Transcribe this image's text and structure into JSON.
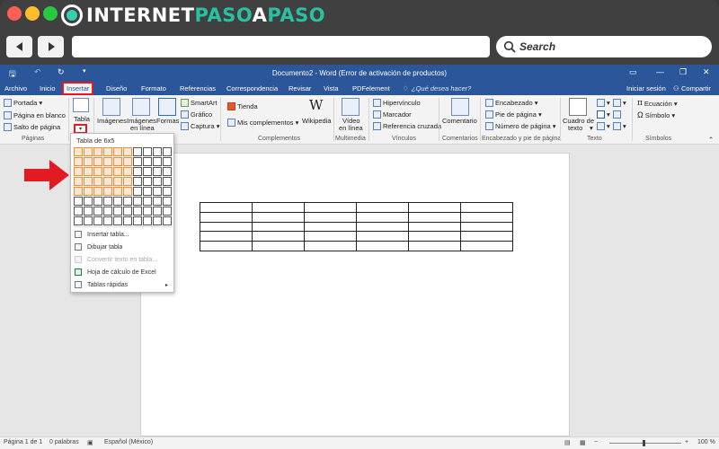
{
  "branding": {
    "logo_part1": "INTERNET",
    "logo_part2": "PASO",
    "logo_part3": "A",
    "logo_part4": "PASO",
    "colors": {
      "logo_white": "#ffffff",
      "logo_teal": "#29c0a3"
    }
  },
  "browser": {
    "search_placeholder": "Search",
    "url_value": ""
  },
  "word": {
    "title": "Documento2 - Word (Error de activación de productos)",
    "accent_color": "#2b579a",
    "tabs": [
      "Archivo",
      "Inicio",
      "Insertar",
      "Diseño",
      "Formato",
      "Referencias",
      "Correspondencia",
      "Revisar",
      "Vista",
      "PDFelement"
    ],
    "active_tab": "Insertar",
    "tell_me": "¿Qué desea hacer?",
    "sign_in": "Iniciar sesión",
    "share": "Compartir"
  },
  "ribbon": {
    "paginas": {
      "portada": "Portada",
      "pagina_en_blanco": "Página en blanco",
      "salto_de_pagina": "Salto de página",
      "label": "Páginas"
    },
    "tabla": {
      "label": "Tabla"
    },
    "ilustraciones": {
      "imagenes": "Imágenes",
      "imagenes_en": "Imágenes",
      "en_linea": "en línea",
      "formas": "Formas",
      "smartart": "SmartArt",
      "grafico": "Gráfico",
      "captura": "Captura"
    },
    "complementos": {
      "tienda": "Tienda",
      "mis_complementos": "Mis complementos",
      "wikipedia": "Wikipedia",
      "label": "Complementos"
    },
    "multimedia": {
      "video": "Vídeo",
      "en_linea": "en línea",
      "label": "Multimedia"
    },
    "vinculos": {
      "hipervinculo": "Hipervínculo",
      "marcador": "Marcador",
      "referencia_cruzada": "Referencia cruzada",
      "label": "Vínculos"
    },
    "comentarios": {
      "comentario": "Comentario",
      "label": "Comentarios"
    },
    "encabezado": {
      "encabezado": "Encabezado",
      "pie_de_pagina": "Pie de página",
      "numero_de_pagina": "Número de página",
      "label": "Encabezado y pie de página"
    },
    "texto": {
      "cuadro_de": "Cuadro de",
      "texto": "texto",
      "label": "Texto"
    },
    "simbolos": {
      "ecuacion": "Ecuación",
      "simbolo": "Símbolo",
      "label": "Símbolos"
    }
  },
  "table_menu": {
    "title": "Tabla de 6x5",
    "grid_cols": 10,
    "grid_rows": 8,
    "selected_cols": 6,
    "selected_rows": 5,
    "items": [
      {
        "label": "Insertar tabla...",
        "disabled": false
      },
      {
        "label": "Dibujar tabla",
        "disabled": false
      },
      {
        "label": "Convertir texto en tabla...",
        "disabled": true
      },
      {
        "label": "Hoja de cálculo de Excel",
        "disabled": false
      },
      {
        "label": "Tablas rápidas",
        "disabled": false
      }
    ]
  },
  "document": {
    "table_cols": 6,
    "table_rows": 5
  },
  "status": {
    "page": "Página 1 de 1",
    "words": "0 palabras",
    "language": "Español (México)",
    "zoom": "100 %"
  }
}
